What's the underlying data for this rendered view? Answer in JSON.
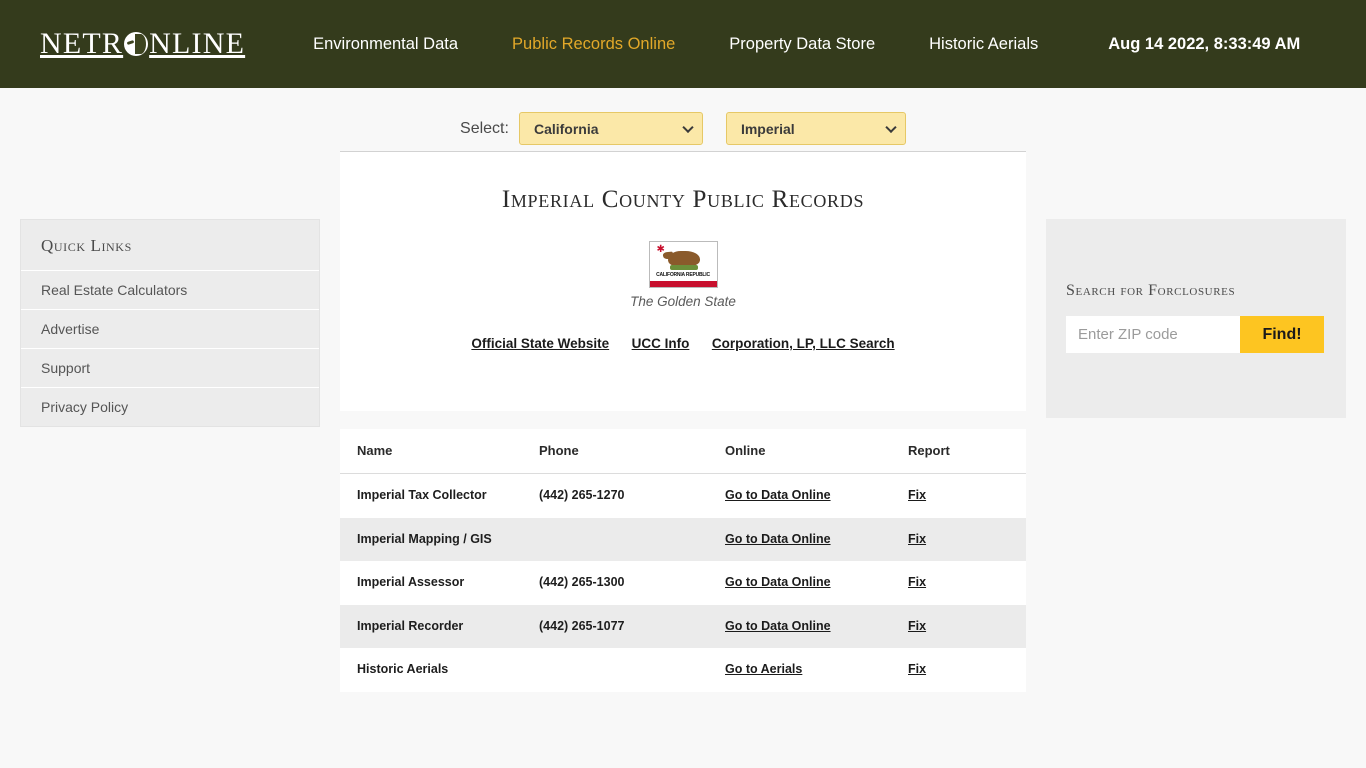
{
  "header": {
    "logo_text_left": "NETR",
    "logo_icon": "globe-icon",
    "logo_text_right": "NLINE",
    "nav": [
      {
        "label": "Environmental Data",
        "active": false
      },
      {
        "label": "Public Records Online",
        "active": true
      },
      {
        "label": "Property Data Store",
        "active": false
      },
      {
        "label": "Historic Aerials",
        "active": false
      }
    ],
    "clock": "Aug 14 2022, 8:33:49 AM",
    "bg_color": "#343b1c",
    "active_nav_color": "#e2a829"
  },
  "sidebar": {
    "title": "Quick Links",
    "items": [
      {
        "label": "Real Estate Calculators"
      },
      {
        "label": "Advertise"
      },
      {
        "label": "Support"
      },
      {
        "label": "Privacy Policy"
      }
    ]
  },
  "select_bar": {
    "label": "Select:",
    "state": {
      "selected": "California",
      "options": [
        "California"
      ]
    },
    "county": {
      "selected": "Imperial",
      "options": [
        "Imperial"
      ]
    },
    "bg_color": "#fbe8a8"
  },
  "main": {
    "title": "Imperial County Public Records",
    "flag": {
      "alt": "California state flag",
      "republic_text": "CALIFORNIA REPUBLIC"
    },
    "flag_caption": "The Golden State",
    "state_links": [
      {
        "label": "Official State Website"
      },
      {
        "label": "UCC Info"
      },
      {
        "label": "Corporation, LP, LLC Search"
      }
    ],
    "table": {
      "columns": [
        "Name",
        "Phone",
        "Online",
        "Report"
      ],
      "rows": [
        {
          "name": "Imperial Tax Collector",
          "phone": "(442) 265-1270",
          "online": "Go to Data Online",
          "report": "Fix",
          "alt": false
        },
        {
          "name": "Imperial Mapping / GIS",
          "phone": "",
          "online": "Go to Data Online",
          "report": "Fix",
          "alt": true
        },
        {
          "name": "Imperial Assessor",
          "phone": "(442) 265-1300",
          "online": "Go to Data Online",
          "report": "Fix",
          "alt": false
        },
        {
          "name": "Imperial Recorder",
          "phone": "(442) 265-1077",
          "online": "Go to Data Online",
          "report": "Fix",
          "alt": true
        },
        {
          "name": "Historic Aerials",
          "phone": "",
          "online": "Go to Aerials",
          "report": "Fix",
          "alt": false
        }
      ]
    }
  },
  "foreclosure": {
    "title": "Search for Forclosures",
    "zip_placeholder": "Enter ZIP code",
    "zip_value": "",
    "find_label": "Find!",
    "button_color": "#fdc521"
  }
}
